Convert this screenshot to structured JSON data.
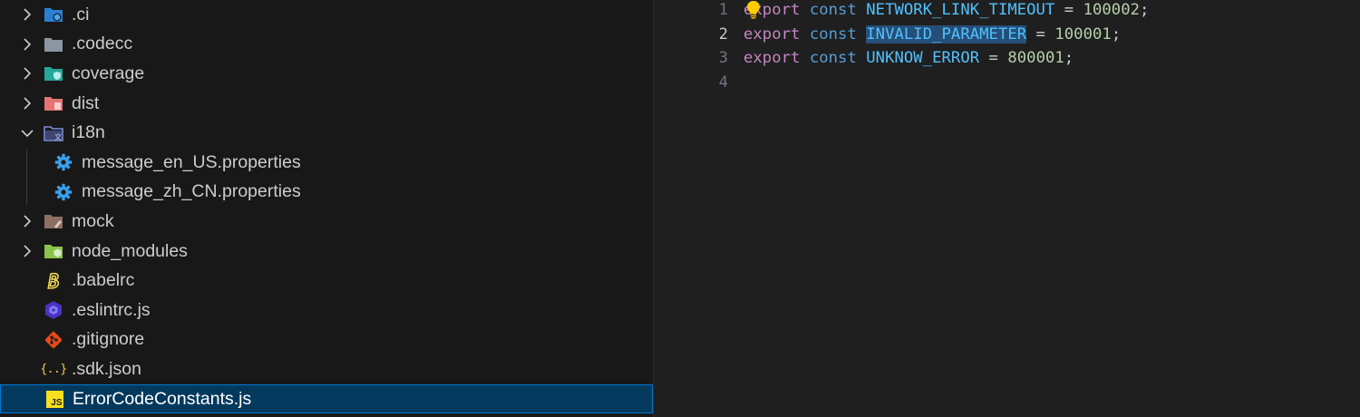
{
  "explorer": {
    "items": [
      {
        "label": ".ci",
        "icon": "folder-ci-icon",
        "expanded": false
      },
      {
        "label": ".codecc",
        "icon": "folder-icon",
        "expanded": false
      },
      {
        "label": "coverage",
        "icon": "folder-coverage-icon",
        "expanded": false
      },
      {
        "label": "dist",
        "icon": "folder-dist-icon",
        "expanded": false
      },
      {
        "label": "i18n",
        "icon": "folder-i18n-icon",
        "expanded": true
      },
      {
        "label": "message_en_US.properties",
        "icon": "gear-icon"
      },
      {
        "label": "message_zh_CN.properties",
        "icon": "gear-icon"
      },
      {
        "label": "mock",
        "icon": "folder-mock-icon",
        "expanded": false
      },
      {
        "label": "node_modules",
        "icon": "folder-node-icon",
        "expanded": false
      },
      {
        "label": ".babelrc",
        "icon": "babel-icon"
      },
      {
        "label": ".eslintrc.js",
        "icon": "eslint-icon"
      },
      {
        "label": ".gitignore",
        "icon": "git-icon"
      },
      {
        "label": ".sdk.json",
        "icon": "json-icon"
      },
      {
        "label": "ErrorCodeConstants.js",
        "icon": "javascript-icon",
        "selected": true
      }
    ],
    "js_badge": "JS",
    "json_badge": "{..}"
  },
  "editor": {
    "line_numbers": [
      "1",
      "2",
      "3",
      "4"
    ],
    "active_line": "2",
    "lines": [
      {
        "kw1": "export",
        "kw2": "const",
        "name": "NETWORK_LINK_TIMEOUT",
        "op": " = ",
        "value": "100002",
        "end": ";"
      },
      {
        "kw1": "export",
        "kw2": "const",
        "name": "INVALID_PARAMETER",
        "op": " = ",
        "value": "100001",
        "end": ";"
      },
      {
        "kw1": "export",
        "kw2": "const",
        "name": "UNKNOW_ERROR",
        "op": " = ",
        "value": "800001",
        "end": ";"
      }
    ]
  },
  "colors": {
    "selection_bg": "#04395e",
    "selection_border": "#0078d4",
    "keyword_export": "#c586c0",
    "keyword_const": "#569cd6",
    "identifier": "#4fc1ff",
    "number": "#b5cea8",
    "lightbulb": "#ffcc00"
  }
}
